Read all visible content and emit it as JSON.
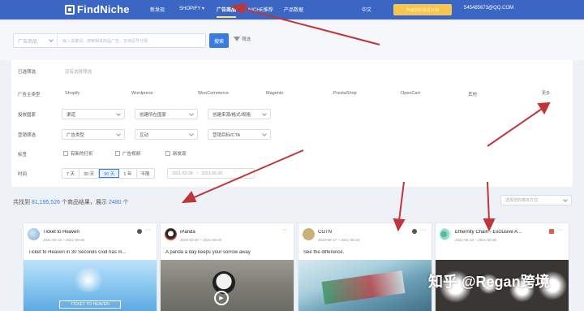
{
  "nav": {
    "logo_text": "FindNiche",
    "items": [
      "新发现",
      "SHOPIFY",
      "广告商品",
      "NICHE推荐",
      "产品数据"
    ],
    "shopify_arrow": "▾",
    "language": "中文",
    "upgrade_label": "升级您的会员计划",
    "user_email": "545485673@QQ.COM"
  },
  "search": {
    "type_placeholder": "广告商品",
    "input_placeholder": "输入关键词，搜索相关商品广告，支持逗号分隔",
    "button_label": "搜索",
    "filter_label": "筛选"
  },
  "filters": {
    "row_labels": [
      "已选筛选",
      "广告主类型",
      "投放国家",
      "营销筛选",
      "标签",
      "时间"
    ],
    "selected_hint": "没有选择筛选",
    "platforms": [
      "Shopify",
      "Wordpress",
      "WooCommerce",
      "Magento",
      "PrestaShop",
      "OpenCart",
      "其他"
    ],
    "more_label": "更多",
    "selects_row1": [
      "渠道",
      "创建所在国家",
      "创建来源/格式/规格"
    ],
    "selects_row2": [
      "广告类型",
      "互动",
      "营销目标/CTA"
    ],
    "checkboxes": [
      "有新的打折",
      "广告视频",
      "新发现"
    ],
    "time_segments": [
      "7 天",
      "30 天",
      "90 天",
      "1 年",
      "不限"
    ],
    "time_selected": "90 天",
    "date_start": "2021-03-28",
    "date_sep": "~",
    "date_end": "2021-06-28"
  },
  "results": {
    "prefix": "共找到",
    "total": "81,195,526",
    "middle": "个商品结果，展示",
    "shown": "2480",
    "suffix": "个",
    "sort_placeholder": "选择您的排序方式"
  },
  "cards": [
    {
      "name": "Ticket to Heaven",
      "date": "2021-06-16 ~ 2021-06-26",
      "desc": "Ticket to Heaven in 30 Seconds God has m...",
      "media_text": "TICKET TO HEAVEN"
    },
    {
      "name": "iPanda",
      "date": "2020-03-20 ~ 2021-06-26",
      "desc": "A panda a day keeps your sorrow away",
      "media_text": ""
    },
    {
      "name": "CGTN",
      "date": "2019-08-17 ~ 2021-06-26",
      "desc": "See the difference.",
      "media_text": ""
    },
    {
      "name": "Ethernity Chain - Exclusive A...",
      "date": "2021-06-16 ~ 2021-06-26",
      "desc": "",
      "media_text": ""
    }
  ],
  "watermark": "知乎 @Regan跨境",
  "colors": {
    "nav_bg": "#3b66c4",
    "accent": "#3a7be0",
    "upgrade": "#f6c64f",
    "arrow": "#c0353a"
  }
}
